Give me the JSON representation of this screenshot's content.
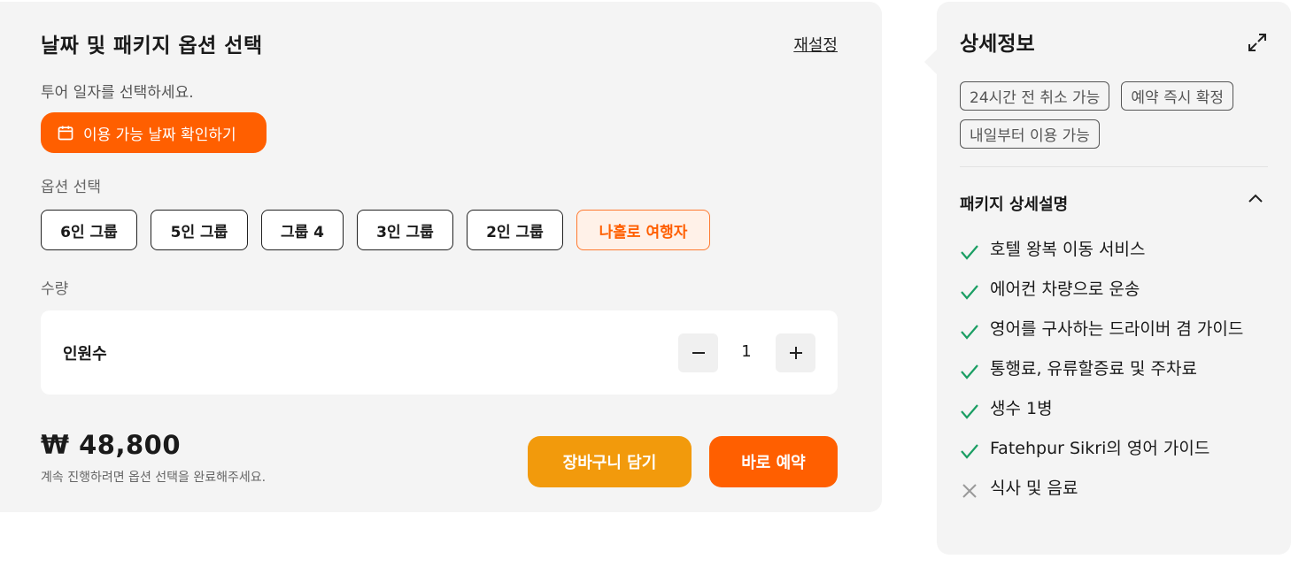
{
  "booking": {
    "title": "날짜 및 패키지 옵션 선택",
    "reset": "재설정",
    "subtitle": "투어 일자를 선택하세요.",
    "date_button": "이용 가능 날짜 확인하기",
    "options_label": "옵션 선택",
    "options": [
      {
        "label": "6인 그룹",
        "selected": false
      },
      {
        "label": "5인 그룹",
        "selected": false
      },
      {
        "label": "그룹 4",
        "selected": false
      },
      {
        "label": "3인 그룹",
        "selected": false
      },
      {
        "label": "2인 그룹",
        "selected": false
      },
      {
        "label": "나홀로 여행자",
        "selected": true
      }
    ],
    "quantity_label": "수량",
    "quantity_name": "인원수",
    "quantity_value": "1",
    "price": "₩ 48,800",
    "note": "계속 진행하려면 옵션 선택을 완료해주세요.",
    "cart_button": "장바구니 담기",
    "book_button": "바로 예약"
  },
  "details": {
    "title": "상세정보",
    "tags": [
      "24시간 전 취소 가능",
      "예약 즉시 확정",
      "내일부터 이용 가능"
    ],
    "package_title": "패키지 상세설명",
    "items": [
      {
        "text": "호텔 왕복 이동 서비스",
        "included": true
      },
      {
        "text": "에어컨 차량으로 운송",
        "included": true
      },
      {
        "text": "영어를 구사하는 드라이버 겸 가이드",
        "included": true
      },
      {
        "text": "통행료, 유류할증료 및 주차료",
        "included": true
      },
      {
        "text": "생수 1병",
        "included": true
      },
      {
        "text": "Fatehpur Sikri의 영어 가이드",
        "included": true
      },
      {
        "text": "식사 및 음료",
        "included": false
      }
    ]
  },
  "colors": {
    "accent": "#ff5f00",
    "cart": "#f29a0c",
    "check": "#1a9e63",
    "cross": "#9a9a9a"
  }
}
